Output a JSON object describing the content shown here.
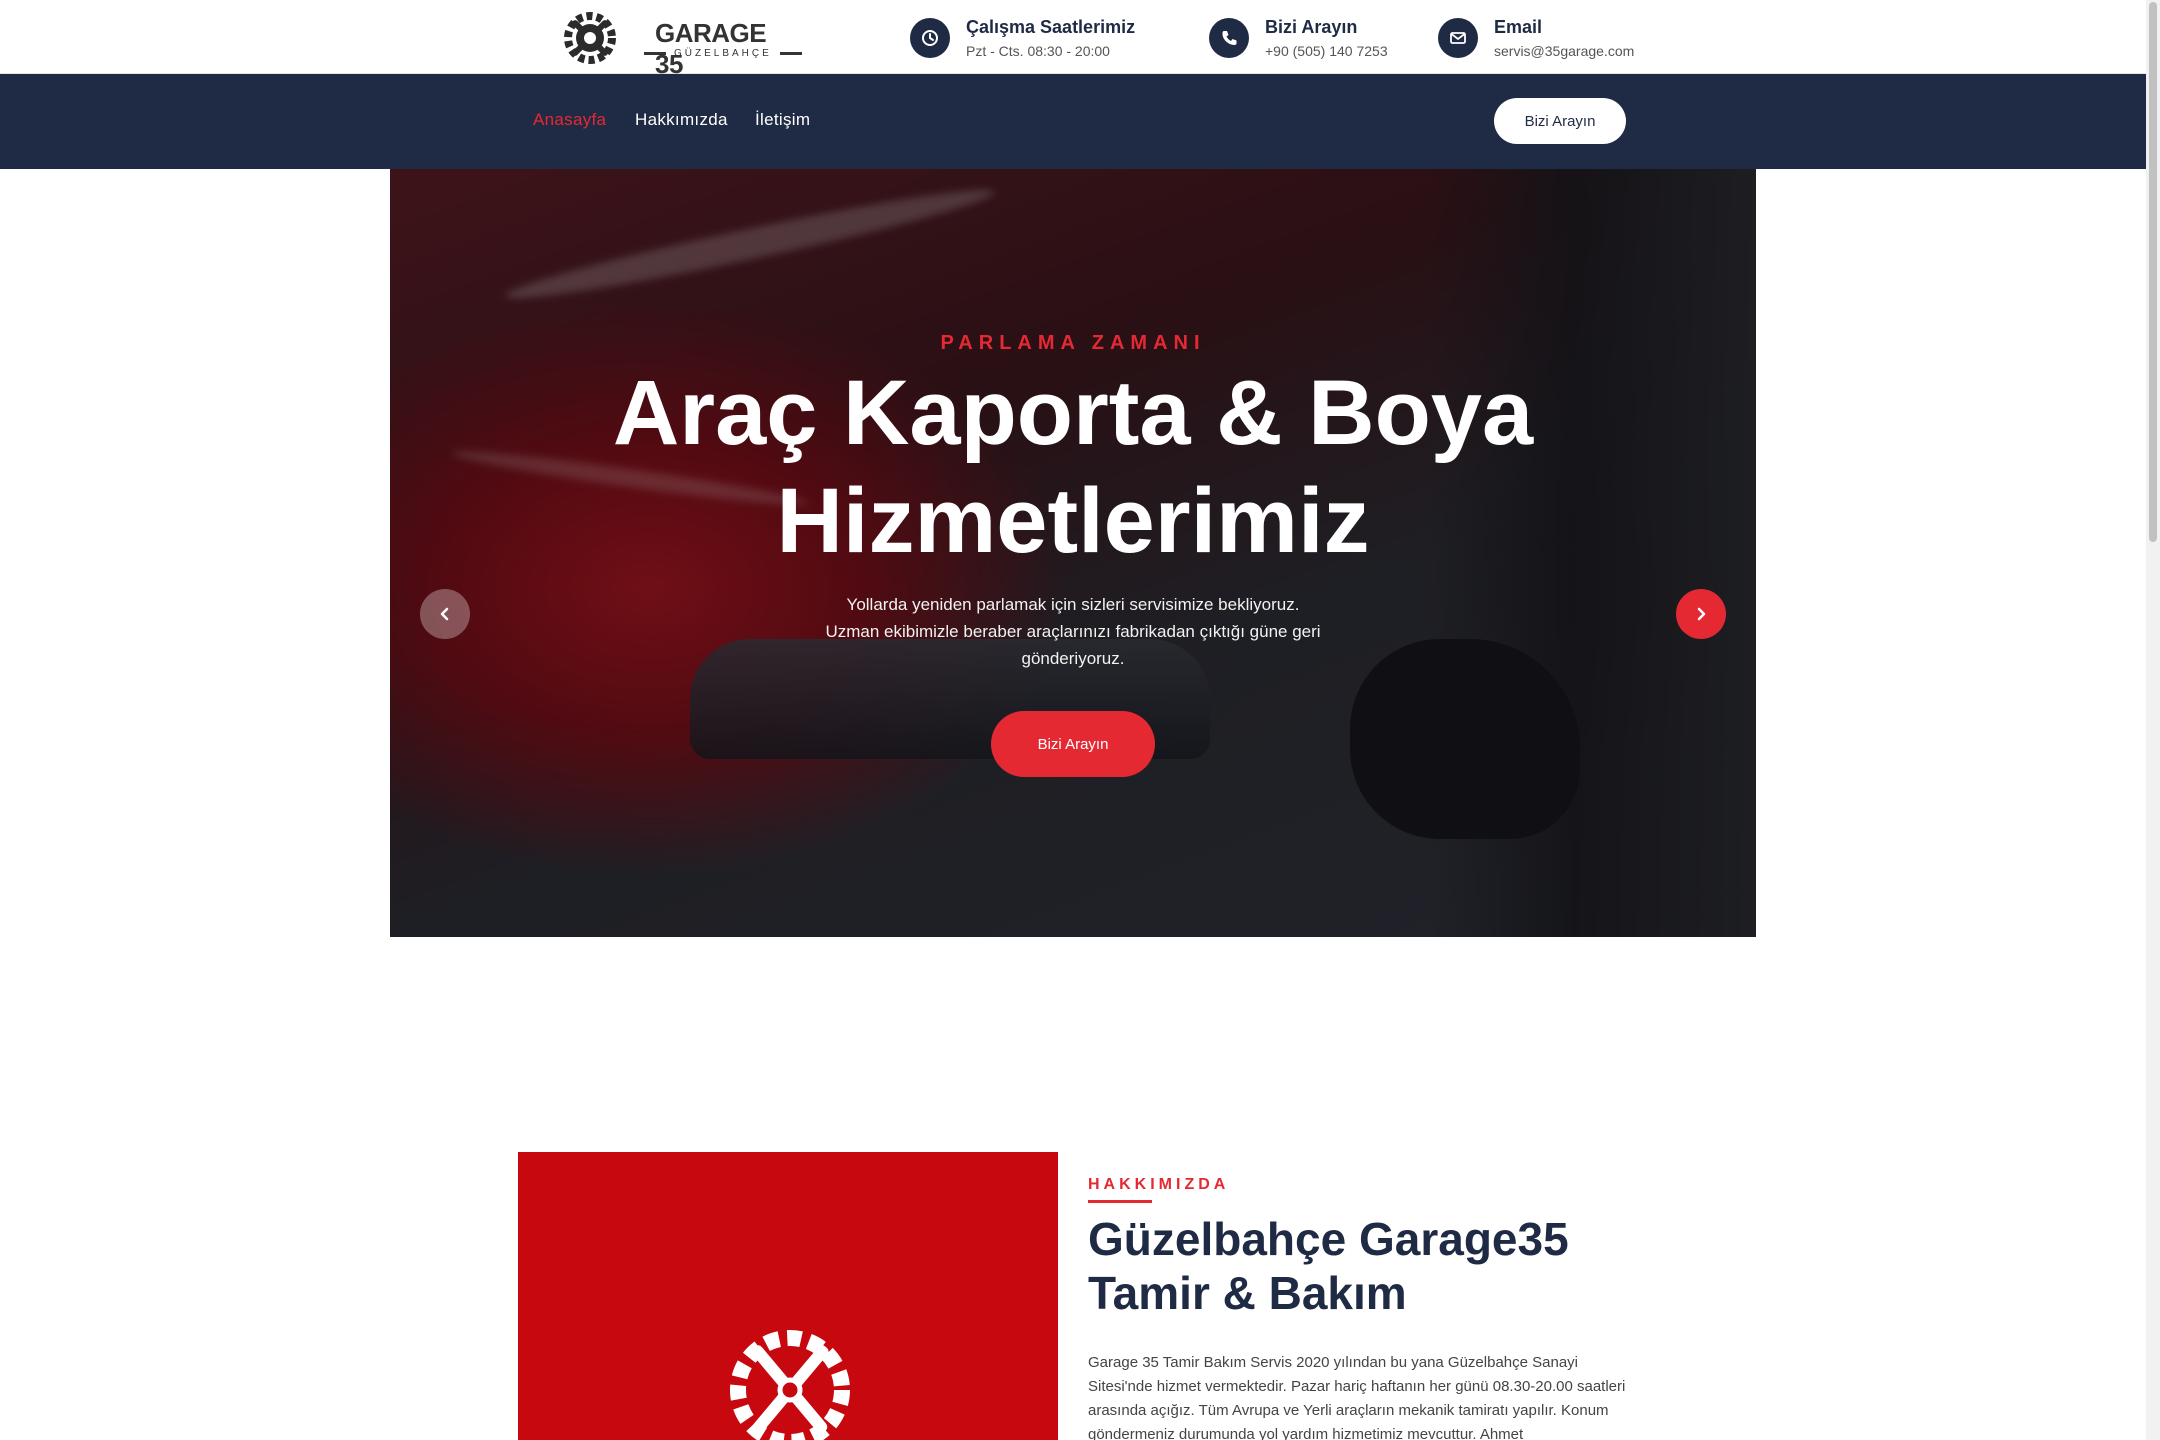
{
  "brand": {
    "name": "GARAGE 35",
    "subtitle": "GÜZELBAHÇE"
  },
  "topbar": {
    "hours": {
      "title": "Çalışma Saatlerimiz",
      "value": "Pzt - Cts. 08:30 - 20:00",
      "icon": "clock-icon"
    },
    "phone": {
      "title": "Bizi Arayın",
      "value": "+90 (505) 140 7253",
      "icon": "phone-icon"
    },
    "email": {
      "title": "Email",
      "value": "servis@35garage.com",
      "icon": "envelope-icon"
    }
  },
  "nav": {
    "items": [
      {
        "label": "Anasayfa",
        "active": true
      },
      {
        "label": "Hakkımızda",
        "active": false
      },
      {
        "label": "İletişim",
        "active": false
      }
    ],
    "cta_label": "Bizi Arayın"
  },
  "hero": {
    "eyebrow": "PARLAMA ZAMANI",
    "title_line1": "Araç Kaporta & Boya",
    "title_line2": "Hizmetlerimiz",
    "text_line1": "Yollarda yeniden parlamak için sizleri servisimize bekliyoruz.",
    "text_line2": "Uzman ekibimizle beraber araçlarınızı fabrikadan çıktığı güne geri gönderiyoruz.",
    "cta_label": "Bizi Arayın",
    "prev_icon": "chevron-left-icon",
    "next_icon": "chevron-right-icon"
  },
  "about": {
    "eyebrow": "HAKKIMIZDA",
    "title_line1": "Güzelbahçe Garage35",
    "title_line2": "Tamir & Bakım",
    "text": "Garage 35 Tamir Bakım Servis 2020 yılından bu yana Güzelbahçe Sanayi Sitesi'nde hizmet vermektedir. Pazar hariç haftanın her günü 08.30-20.00 saatleri arasında açığız. Tüm Avrupa ve Yerli araçların mekanik tamiratı yapılır. Konum göndermeniz durumunda yol yardım hizmetimiz mevcuttur. Ahmet"
  },
  "colors": {
    "accent": "#e52933",
    "navy": "#1f2a44",
    "about_block": "#c8080f"
  }
}
